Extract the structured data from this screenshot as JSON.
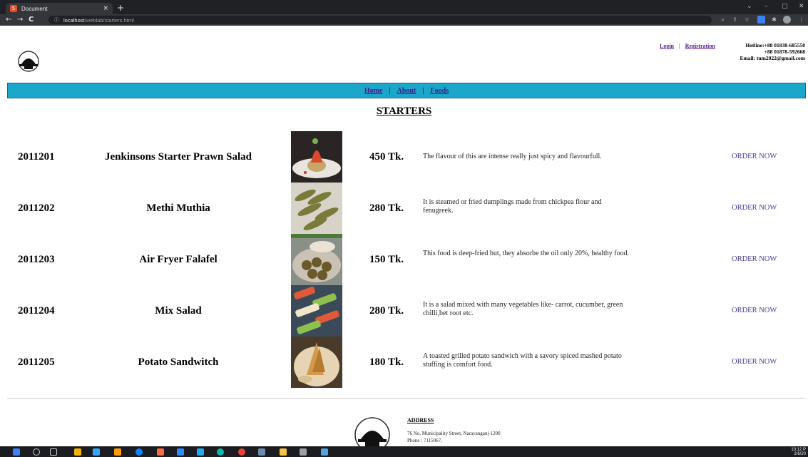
{
  "browser": {
    "tab_title": "Document",
    "tab_close": "×",
    "new_tab": "+",
    "url_host": "localhost",
    "url_path": "/weblab/starters.html",
    "info_icon": "ⓘ",
    "back": "←",
    "forward": "→",
    "reload": "C",
    "window_controls": {
      "chevron": "⌄",
      "minimize": "–",
      "maximize": "▢",
      "close": "✕"
    }
  },
  "header": {
    "login": "Login",
    "separator": "|",
    "registration": "Registration",
    "hotline_1": "Hotline:+88 01838-685550",
    "hotline_2": "+88 01878-592668",
    "email": "Email: tum2022@gmail.com"
  },
  "nav": {
    "home": "Home",
    "about": "About",
    "foods": "Foods",
    "separator": "|"
  },
  "page_title": "STARTERS",
  "items": [
    {
      "code": "2011201",
      "name": "Jenkinsons Starter Prawn Salad",
      "price": "450 Tk.",
      "description": "The flavour of this are intense really just spicy and flavourfull.",
      "order": "ORDER NOW",
      "image_icon": "prawn-salad-photo"
    },
    {
      "code": "2011202",
      "name": "Methi Muthia",
      "price": "280 Tk.",
      "description": "It is steamed or fried dumplings made from chickpea flour and fenugreek.",
      "order": "ORDER NOW",
      "image_icon": "methi-muthia-photo"
    },
    {
      "code": "2011203",
      "name": "Air Fryer Falafel",
      "price": "150 Tk.",
      "description": "This food is deep-fried but, they absorbe the oil only 20%, healthy food.",
      "order": "ORDER NOW",
      "image_icon": "falafel-photo"
    },
    {
      "code": "2011204",
      "name": "Mix Salad",
      "price": "280 Tk.",
      "description": "It is a salad mixed with many vegetables like- carrot, cucumber, green chilli,bet root etc.",
      "order": "ORDER NOW",
      "image_icon": "mix-salad-photo"
    },
    {
      "code": "2011205",
      "name": "Potato Sandwitch",
      "price": "180 Tk.",
      "description": "A toasted grilled potato sandwich with a savory spiced mashed potato stuffing is comfort food.",
      "order": "ORDER NOW",
      "image_icon": "potato-sandwich-photo"
    }
  ],
  "footer": {
    "address_title": "ADDRESS",
    "address_line": "76 No, Municipality Street, Narayanganj-1200",
    "phone": "Phone : 7115067,"
  },
  "taskbar": {
    "time": "10:12 P",
    "date": "2/6/20"
  },
  "colors": {
    "nav_bg": "#1aa7c9",
    "link": "#3b1d86",
    "order": "#4b3a8c"
  }
}
